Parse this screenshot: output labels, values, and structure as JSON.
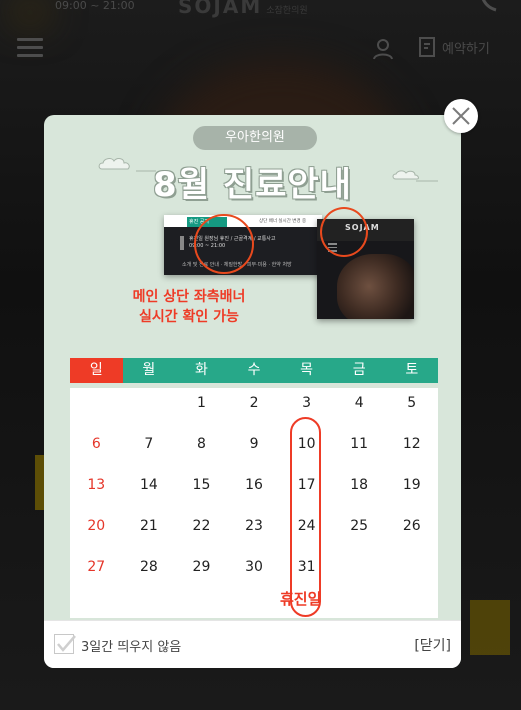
{
  "background": {
    "hours_label": "09:00 ~ 21:00",
    "logo": "SOJAM",
    "logo_sub": "소잠한의원",
    "book_label": "예약하기"
  },
  "popup": {
    "clinic_name": "우아한의원",
    "title": "8월 진료안내",
    "screenshot1": {
      "tab_label": "휴진 공지",
      "tab_right": "상단 배너 실시간 변경 중",
      "line1": "휴진일 원장님 휴진 / 근골격계 / 교통사고",
      "line2": "09:00 ~ 21:00",
      "menu": "소개 및 진료 안내 · 체질한방 · 피부·미용 · 한약 처방"
    },
    "screenshot2": {
      "logo": "SOJAM",
      "sub": "진료 08:00~21:00"
    },
    "callout_line1": "메인 상단 좌측배너",
    "callout_line2": "실시간 확인 가능",
    "calendar": {
      "weekdays": [
        "일",
        "월",
        "화",
        "수",
        "목",
        "금",
        "토"
      ],
      "weeks": [
        [
          "",
          "",
          "1",
          "2",
          "3",
          "4",
          "5"
        ],
        [
          "6",
          "7",
          "8",
          "9",
          "10",
          "11",
          "12"
        ],
        [
          "13",
          "14",
          "15",
          "16",
          "17",
          "18",
          "19"
        ],
        [
          "20",
          "21",
          "22",
          "23",
          "24",
          "25",
          "26"
        ],
        [
          "27",
          "28",
          "29",
          "30",
          "31",
          "",
          ""
        ]
      ],
      "holiday_label": "휴진일",
      "accent_color": "#27a889",
      "sunday_color": "#ee3b26"
    },
    "footer": {
      "checkbox_label": "3일간 띄우지 않음",
      "checkbox_checked": true,
      "close_label": "[닫기]"
    }
  }
}
